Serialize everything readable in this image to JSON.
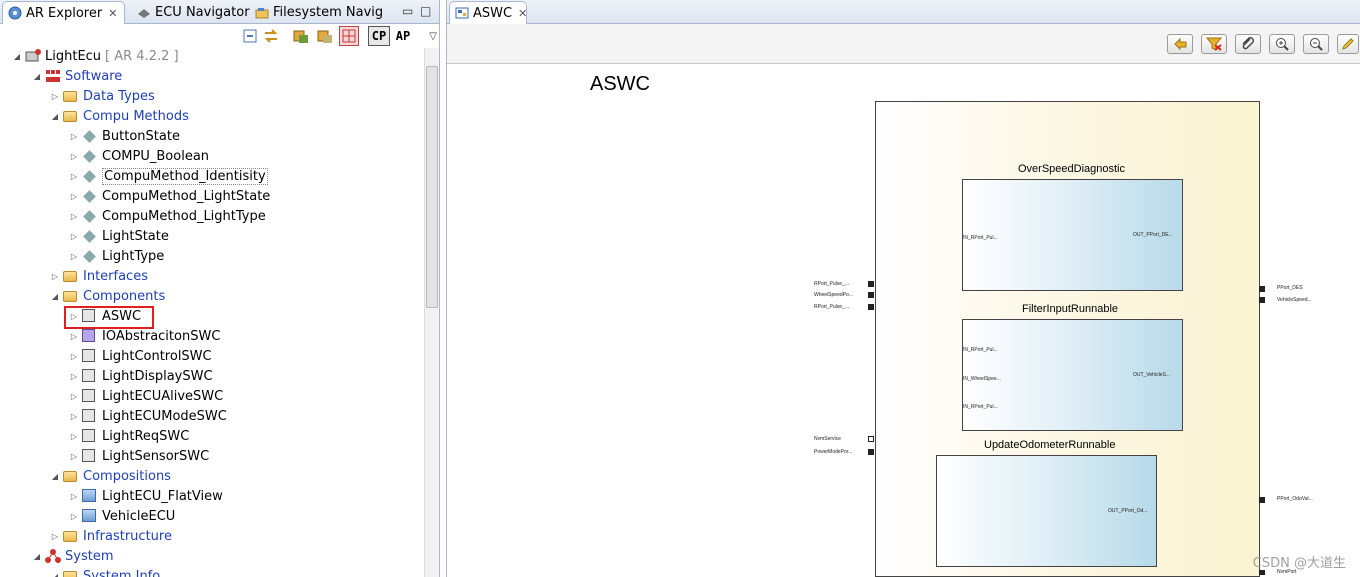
{
  "left_pane": {
    "tabs": [
      {
        "label": "AR Explorer",
        "close": "✕"
      },
      {
        "label": "ECU Navigator"
      },
      {
        "label": "Filesystem Navig"
      }
    ],
    "toolbar": {
      "cp_label": "CP",
      "ap_label": "AP"
    },
    "tree": {
      "root_label": "LightEcu",
      "root_version": "[ AR 4.2.2 ]",
      "software": "Software",
      "data_types": "Data Types",
      "compu_methods": "Compu Methods",
      "compu_items": [
        "ButtonState",
        "COMPU_Boolean",
        "CompuMethod_Identisity",
        "CompuMethod_LightState",
        "CompuMethod_LightType",
        "LightState",
        "LightType"
      ],
      "interfaces": "Interfaces",
      "components": "Components",
      "component_items": [
        "ASWC",
        "IOAbstracitonSWC",
        "LightControlSWC",
        "LightDisplaySWC",
        "LightECUAliveSWC",
        "LightECUModeSWC",
        "LightReqSWC",
        "LightSensorSWC"
      ],
      "compositions": "Compositions",
      "composition_items": [
        "LightECU_FlatView",
        "VehicleECU"
      ],
      "infrastructure": "Infrastructure",
      "system": "System",
      "system_info": "System Info"
    }
  },
  "editor": {
    "tab_label": "ASWC",
    "tab_close": "✕",
    "diagram": {
      "title": "ASWC",
      "runnables": [
        {
          "name": "OverSpeedDiagnostic",
          "inputs": [
            "IN_RPort_Pul..."
          ],
          "outputs": [
            "OUT_PPort_DE..."
          ]
        },
        {
          "name": "FilterInputRunnable",
          "inputs": [
            "IN_RPort_Pul...",
            "IN_WheelSpee...",
            "IN_RPort_Pul..."
          ],
          "outputs": [
            "OUT_VehicleS..."
          ]
        },
        {
          "name": "UpdateOdometerRunnable",
          "inputs": [],
          "outputs": [
            "OUT_PPort_Od..."
          ]
        }
      ],
      "left_ports": [
        "RPort_Pulse_...",
        "WheelSpeedPo...",
        "RPort_Pulse_...",
        "NvmService",
        "PowerModePor..."
      ],
      "right_ports": [
        "PPort_DES",
        "VehicleSpeed...",
        "PPort_OdoVal...",
        "NvmPort"
      ]
    }
  },
  "watermark": "CSDN @大道生"
}
